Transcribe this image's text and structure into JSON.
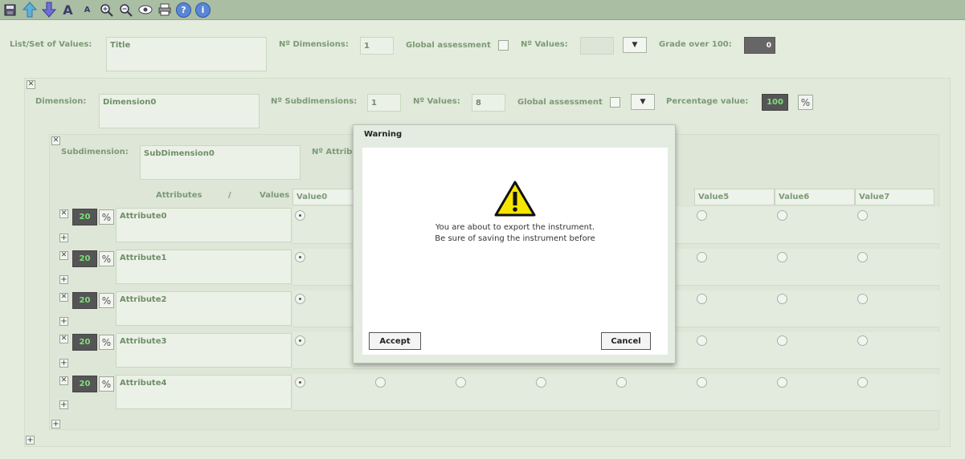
{
  "toolbar": {
    "icons": [
      "save-icon",
      "arrow-up-icon",
      "arrow-down-icon",
      "font-larger-icon",
      "font-smaller-icon",
      "zoom-in-icon",
      "zoom-out-icon",
      "eye-icon",
      "print-icon",
      "help-icon",
      "info-icon"
    ],
    "font_large": "A",
    "font_small": "A",
    "help_glyph": "?",
    "info_glyph": "i"
  },
  "header": {
    "list_label": "List/Set of Values:",
    "title_value": "Title",
    "dimensions_label": "Nº Dimensions:",
    "dimensions_value": "1",
    "global_label": "Global assessment",
    "values_label": "Nº Values:",
    "grade_label": "Grade over 100:",
    "grade_value": "0"
  },
  "dimension": {
    "label": "Dimension:",
    "name": "Dimension0",
    "subdims_label": "Nº Subdimensions:",
    "subdims_value": "1",
    "values_label": "Nº Values:",
    "values_value": "8",
    "global_label": "Global assessment",
    "pct_label": "Percentage value:",
    "pct_value": "100"
  },
  "subdimension": {
    "label": "Subdimension:",
    "name": "SubDimension0",
    "attr_label_partial": "Nº Attribu",
    "attributes_header": "Attributes",
    "slash": "/",
    "values_header": "Values",
    "columns": [
      "Value0",
      "Value5",
      "Value6",
      "Value7"
    ]
  },
  "attributes": [
    {
      "weight": "20",
      "name": "Attribute0"
    },
    {
      "weight": "20",
      "name": "Attribute1"
    },
    {
      "weight": "20",
      "name": "Attribute2"
    },
    {
      "weight": "20",
      "name": "Attribute3"
    },
    {
      "weight": "20",
      "name": "Attribute4"
    }
  ],
  "dialog": {
    "title": "Warning",
    "line1": "You are about to export the instrument.",
    "line2": "Be sure of saving the instrument before",
    "accept": "Accept",
    "cancel": "Cancel",
    "icon": "warning-icon"
  },
  "colors": {
    "accent_green": "#7de07a",
    "label_green": "#7d9a75",
    "warning_yellow": "#f5e600"
  }
}
